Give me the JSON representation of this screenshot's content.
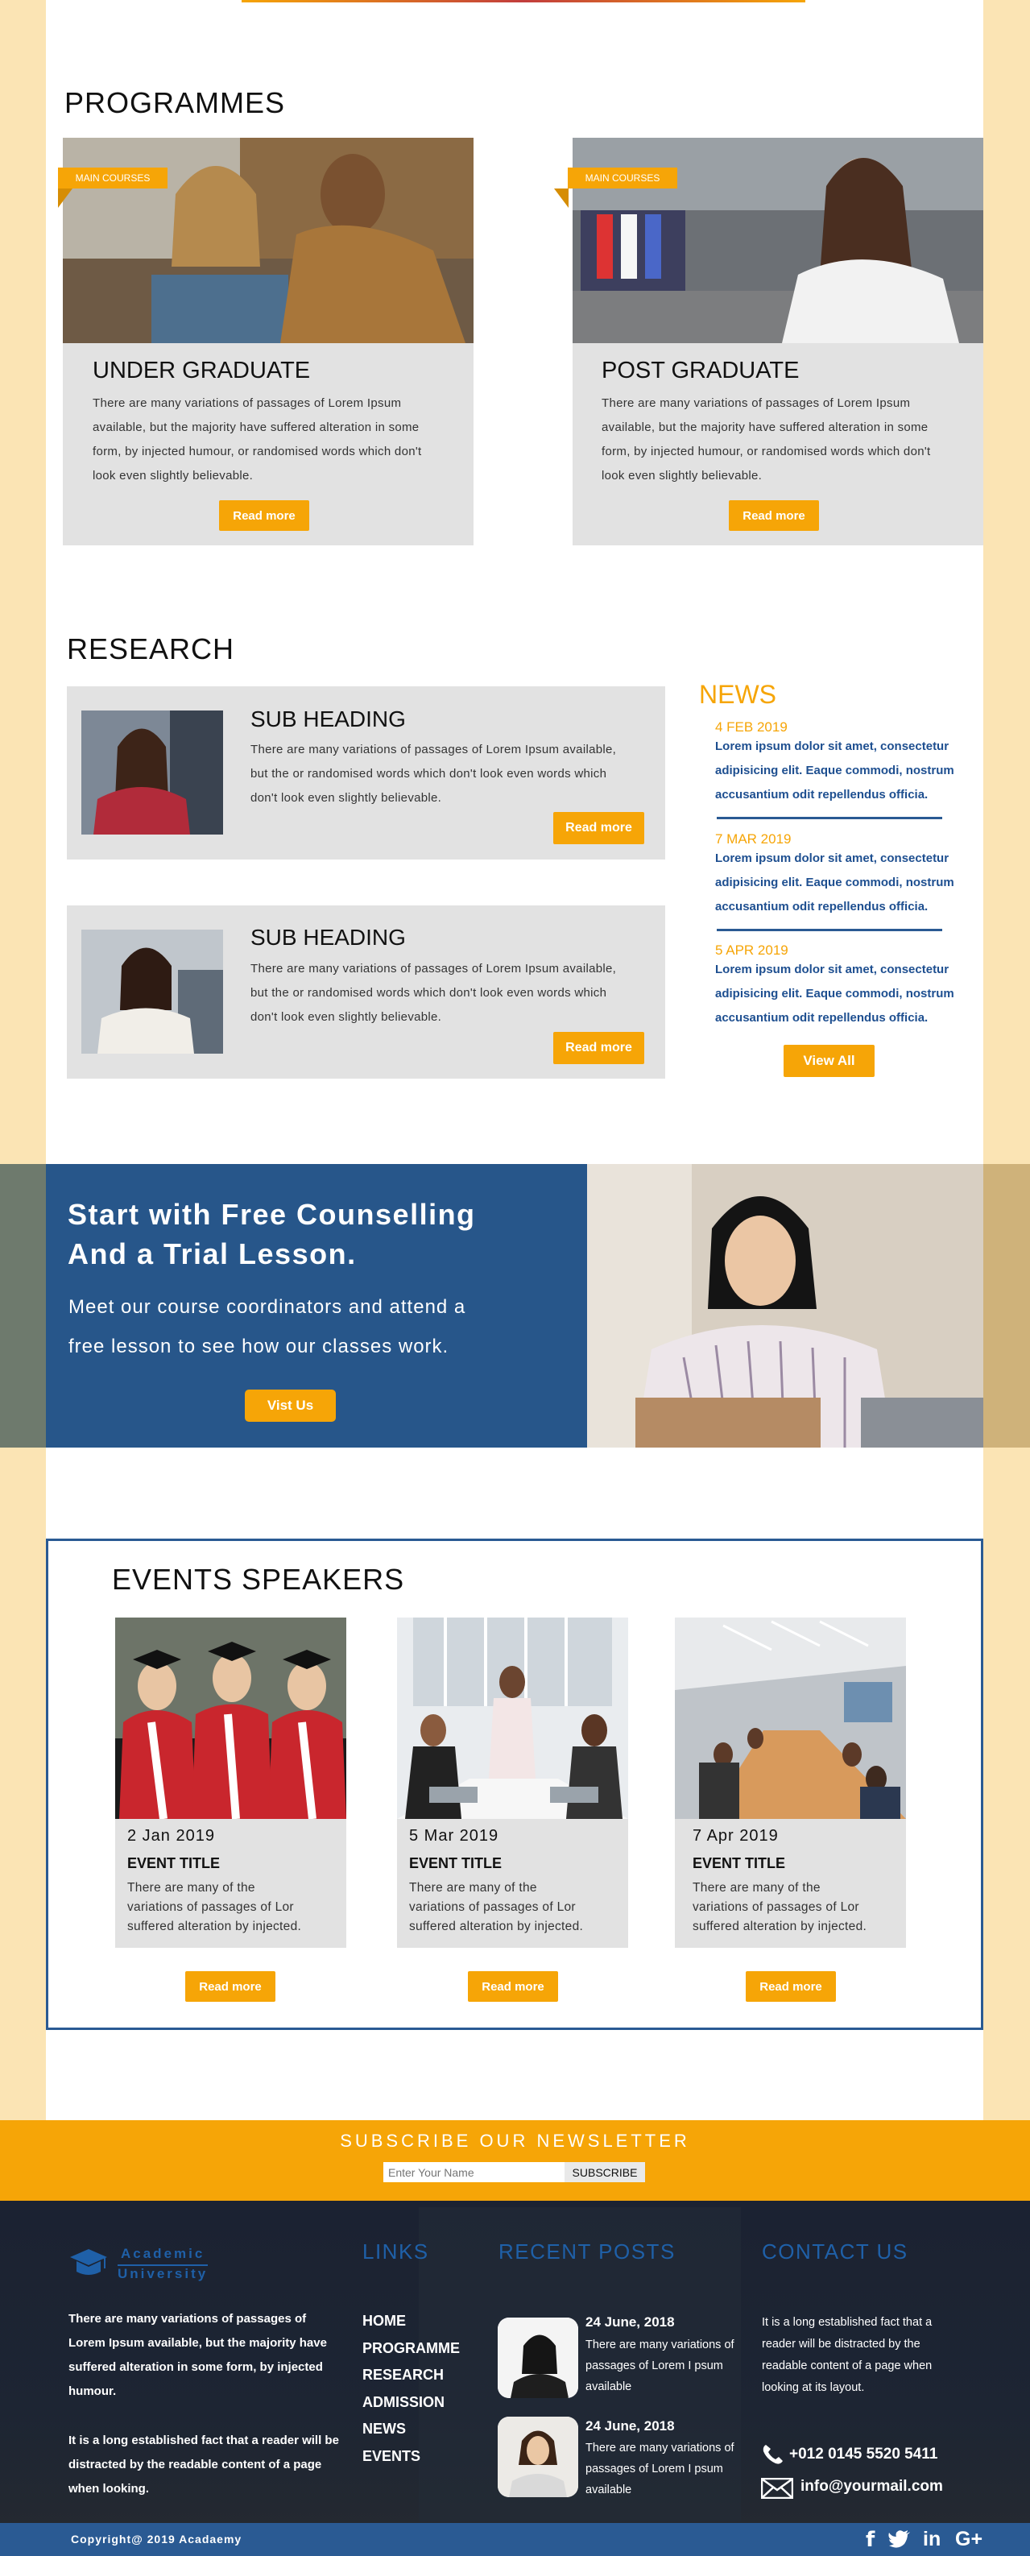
{
  "programmes": {
    "title": "PROGRAMMES",
    "cards": [
      {
        "tag": "MAIN COURSES",
        "title": "UNDER GRADUATE",
        "text": "There are many variations of passages of Lorem Ipsum available, but the majority have suffered alteration in some form, by injected humour, or randomised words which don't look even slightly believable.",
        "button": "Read more"
      },
      {
        "tag": "MAIN COURSES",
        "title": "POST GRADUATE",
        "text": "There are many variations of passages of Lorem Ipsum available, but the majority have suffered alteration in some form, by injected humour, or randomised words which don't look even slightly believable.",
        "button": "Read more"
      }
    ]
  },
  "research": {
    "title": "RESEARCH",
    "items": [
      {
        "title": "SUB HEADING",
        "text": "There are many variations of passages of Lorem Ipsum available, but the  or randomised words which don't look even  words which don't look even slightly believable.",
        "button": "Read more"
      },
      {
        "title": "SUB HEADING",
        "text": "There are many variations of passages of Lorem Ipsum available, but the  or randomised words which don't look even  words which don't look even slightly believable.",
        "button": "Read more"
      }
    ]
  },
  "news": {
    "title": "NEWS",
    "items": [
      {
        "date": "4 FEB 2019",
        "text": "Lorem ipsum dolor sit amet, consectetur adipisicing elit. Eaque commodi, nostrum accusantium odit repellendus officia."
      },
      {
        "date": "7 MAR 2019",
        "text": "Lorem ipsum dolor sit amet, consectetur adipisicing elit. Eaque commodi, nostrum accusantium odit repellendus officia."
      },
      {
        "date": "5 APR 2019",
        "text": "Lorem ipsum dolor sit amet, consectetur adipisicing elit. Eaque commodi, nostrum accusantium odit repellendus officia."
      }
    ],
    "button": "View All"
  },
  "counselling": {
    "line1": "Start with Free Counselling",
    "line2": "And a Trial Lesson.",
    "text1": "Meet our course coordinators and attend a",
    "text2": "free lesson to see how our classes work.",
    "button": "Vist Us"
  },
  "events": {
    "title": "EVENTS SPEAKERS",
    "items": [
      {
        "date": "2 Jan 2019",
        "title": "EVENT TITLE",
        "l1": "There are many of the",
        "l2": "variations of passages of Lor",
        "l3": "suffered alteration by injected.",
        "button": "Read more"
      },
      {
        "date": "5 Mar 2019",
        "title": "EVENT TITLE",
        "l1": "There are many of the",
        "l2": "variations of passages of Lor",
        "l3": "suffered alteration by injected.",
        "button": "Read more"
      },
      {
        "date": "7 Apr 2019",
        "title": "EVENT TITLE",
        "l1": "There are many of the",
        "l2": "variations of passages of Lor",
        "l3": "suffered alteration by injected.",
        "button": "Read more"
      }
    ]
  },
  "newsletter": {
    "title": "SUBSCRIBE OUR NEWSLETTER",
    "placeholder": "Enter Your Name",
    "button": "SUBSCRIBE"
  },
  "footer": {
    "logo_line1": "Academic",
    "logo_line2": "University",
    "about1": "There are many variations of passages of Lorem Ipsum available, but the majority have suffered alteration in some form,  by injected humour.",
    "about2": "It is a long established fact that a reader will be distracted by the readable content of a page when looking.",
    "links_title": "LINKS",
    "links": [
      "HOME",
      "PROGRAMME",
      "RESEARCH",
      "ADMISSION",
      "NEWS",
      "EVENTS"
    ],
    "posts_title": "RECENT POSTS",
    "posts": [
      {
        "date": "24 June, 2018",
        "text": "There are many variations of passages of Lorem I psum available"
      },
      {
        "date": "24 June, 2018",
        "text": "There are many variations of passages of Lorem I psum available"
      }
    ],
    "contact_title": "CONTACT US",
    "contact_text": "It is a long established fact that a reader will be distracted by the readable content of a page when looking at its layout.",
    "phone": "+012 0145 5520 5411",
    "email": "info@yourmail.com",
    "copyright": "Copyright@ 2019 Acadaemy",
    "social": [
      "facebook-icon",
      "twitter-icon",
      "linkedin-icon",
      "google-plus-icon"
    ]
  },
  "colors": {
    "accent": "#f6a507",
    "navy": "#27568a",
    "cream": "#fbe4b4",
    "card": "#e2e2e2"
  }
}
